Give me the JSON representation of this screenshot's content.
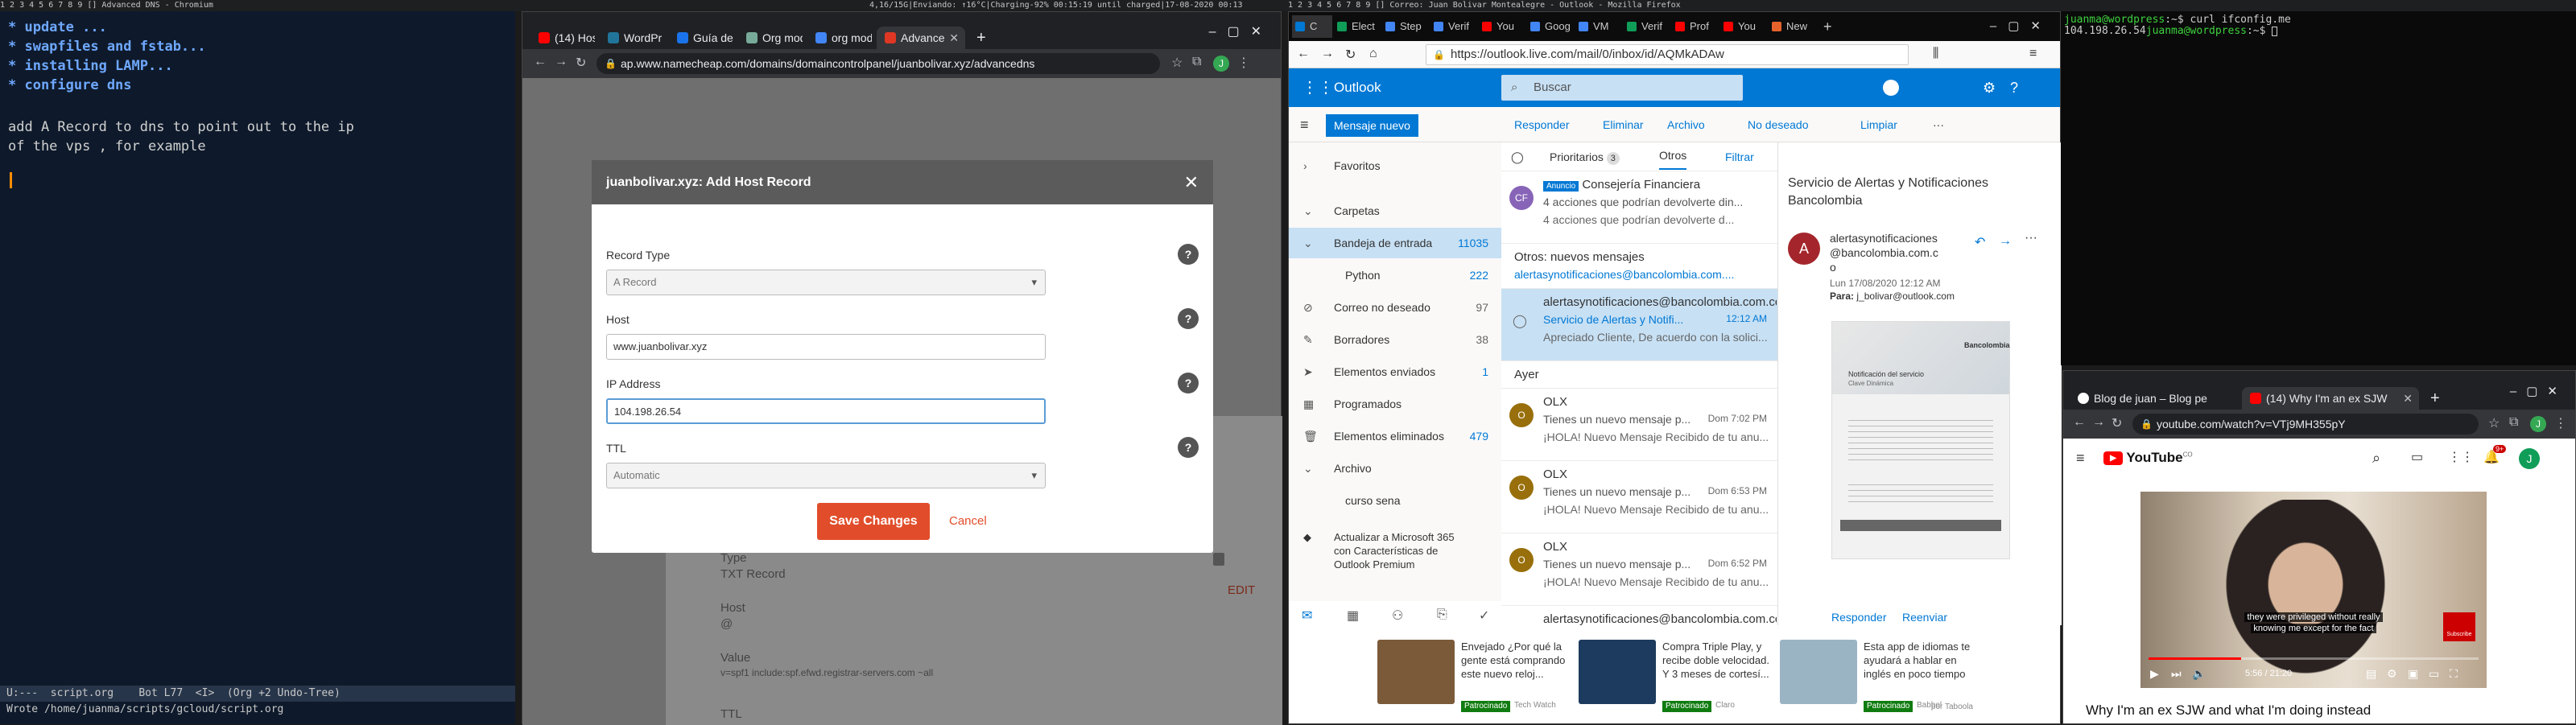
{
  "topbar_left": "1 2 3 4 5 6 7 8 9 [] Advanced DNS - Chromium",
  "topbar_mid": "4,16/15G|Enviando: ↑16°C|Charging-92% 00:15:19 until charged|17-08-2020 00:13",
  "topbar_right": "1 2 3 4 5 6 7 8 9 [] Correo: Juan Bolivar Montealegre - Outlook - Mozilla Firefox",
  "emacs": {
    "lines": [
      "* update ...",
      "* swapfiles and fstab...",
      "* installing LAMP...",
      "* configure dns"
    ],
    "body": [
      "add A Record to dns to point out to the ip",
      "of the vps , for example"
    ],
    "modeline": "U:---  script.org    Bot L77  <I>  (Org +2 Undo-Tree)",
    "minibuffer": "Wrote /home/juanma/scripts/gcloud/script.org"
  },
  "chrome1": {
    "tabs": [
      {
        "label": "(14) Hos",
        "color": "#ff0000"
      },
      {
        "label": "WordPr",
        "color": "#21759b"
      },
      {
        "label": "Guía de",
        "color": "#1a73e8"
      },
      {
        "label": "Org mod",
        "color": "#77aa99"
      },
      {
        "label": "org mod",
        "color": "#4285f4"
      },
      {
        "label": "Advance",
        "color": "#de3723"
      }
    ],
    "url": "ap.www.namecheap.com/domains/domaincontrolpanel/juanbolivar.xyz/advancedns",
    "avatar": "J"
  },
  "modal": {
    "title": "juanbolivar.xyz: Add Host Record",
    "record_type_label": "Record Type",
    "record_type_value": "A Record",
    "host_label": "Host",
    "host_value": "www.juanbolivar.xyz",
    "ip_label": "IP Address",
    "ip_value": "104.198.26.54",
    "ttl_label": "TTL",
    "ttl_value": "Automatic",
    "save_label": "Save Changes",
    "cancel_label": "Cancel",
    "help": "?"
  },
  "bg_records": {
    "type_label": "Type",
    "type_value": "TXT Record",
    "host_label": "Host",
    "host_value": "@",
    "value_label": "Value",
    "value_value": "v=spf1 include:spf.efwd.registrar-servers.com ~all",
    "ttl_label": "TTL",
    "edit_label": "EDIT"
  },
  "firefox": {
    "tabs": [
      {
        "label": "C",
        "color": "#0078d4"
      },
      {
        "label": "Elect",
        "color": "#0f9d58"
      },
      {
        "label": "Step",
        "color": "#4285f4"
      },
      {
        "label": "Verif",
        "color": "#4285f4"
      },
      {
        "label": "You",
        "color": "#ff0000"
      },
      {
        "label": "Goog",
        "color": "#4285f4"
      },
      {
        "label": "VM",
        "color": "#4285f4"
      },
      {
        "label": "Verif",
        "color": "#0f9d58"
      },
      {
        "label": "Prof",
        "color": "#ff0000"
      },
      {
        "label": "You",
        "color": "#ff0000"
      },
      {
        "label": "New",
        "color": "#e8632b"
      }
    ],
    "url": "https://outlook.live.com/mail/0/inbox/id/AQMkADAw"
  },
  "outlook": {
    "app_name": "Outlook",
    "search_placeholder": "Buscar",
    "new_message": "Mensaje nuevo",
    "commands": [
      "Responder",
      "Eliminar",
      "Archivo",
      "No deseado",
      "Limpiar",
      "···"
    ],
    "nav": [
      {
        "label": "Favoritos",
        "count": ""
      },
      {
        "label": "Carpetas",
        "count": ""
      },
      {
        "label": "Bandeja de entrada",
        "count": "11035"
      },
      {
        "label": "Python",
        "count": "222"
      },
      {
        "label": "Correo no deseado",
        "count": "97"
      },
      {
        "label": "Borradores",
        "count": "38"
      },
      {
        "label": "Elementos enviados",
        "count": "1"
      },
      {
        "label": "Programados",
        "count": ""
      },
      {
        "label": "Elementos eliminados",
        "count": "479"
      },
      {
        "label": "Archivo",
        "count": ""
      },
      {
        "label": "curso sena",
        "count": ""
      }
    ],
    "upgrade": [
      "Actualizar a Microsoft 365",
      "con Características de",
      "Outlook Premium"
    ],
    "list_tabs": {
      "focused": "Prioritarios",
      "focused_count": "3",
      "other": "Otros",
      "filter": "Filtrar"
    },
    "messages": [
      {
        "avatar": "CF",
        "color": "#8764b8",
        "badge": "Anuncio",
        "from": "Consejería Financiera",
        "subject": "4 acciones que podrían devolverte din...",
        "preview": "4 acciones que podrían devolverte d...",
        "time": ""
      },
      {
        "avatar": "",
        "color": "",
        "badge": "",
        "from": "Otros: nuevos mensajes",
        "subject": "alertasynotificaciones@bancolombia.com....",
        "preview": "",
        "time": ""
      },
      {
        "avatar": "",
        "color": "",
        "badge": "",
        "from": "alertasynotificaciones@bancolombia.com.cc",
        "subject": "Servicio de Alertas y Notifi...",
        "preview": "Apreciado Cliente, De acuerdo con la solici...",
        "time": "12:12 AM"
      },
      {
        "avatar": "",
        "color": "",
        "badge": "",
        "from": "Ayer",
        "subject": "",
        "preview": "",
        "time": ""
      },
      {
        "avatar": "O",
        "color": "#986f0b",
        "badge": "",
        "from": "OLX",
        "subject": "Tienes un nuevo mensaje p...",
        "preview": "¡HOLA! Nuevo Mensaje Recibido de tu anu...",
        "time": "Dom 7:02 PM"
      },
      {
        "avatar": "O",
        "color": "#986f0b",
        "badge": "",
        "from": "OLX",
        "subject": "Tienes un nuevo mensaje p...",
        "preview": "¡HOLA! Nuevo Mensaje Recibido de tu anu...",
        "time": "Dom 6:53 PM"
      },
      {
        "avatar": "O",
        "color": "#986f0b",
        "badge": "",
        "from": "OLX",
        "subject": "Tienes un nuevo mensaje p...",
        "preview": "¡HOLA! Nuevo Mensaje Recibido de tu anu...",
        "time": "Dom 6:52 PM"
      },
      {
        "avatar": "",
        "color": "",
        "badge": "",
        "from": "alertasynotificaciones@bancolombia.com.cc",
        "subject": "",
        "preview": "",
        "time": ""
      }
    ],
    "reading": {
      "subject": "Servicio de Alertas y Notificaciones Bancolombia",
      "sender_avatar": "A",
      "sender": [
        "alertasynotificaciones",
        "@bancolombia.com.c",
        "o"
      ],
      "date": "Lun 17/08/2020 12:12 AM",
      "to_label": "Para:",
      "to": "j_bolivar@outlook.com",
      "reply": "Responder",
      "forward": "Reenviar",
      "email_heading": "Notificación del servicio",
      "email_sub": "Clave Dinámica",
      "email_brand": "Bancolombia"
    },
    "ads": [
      {
        "text": "Envejado ¿Por qué la gente está comprando este nuevo reloj...",
        "badge": "Patrocinado",
        "source": "Tech Watch",
        "color": "#7b5a3a"
      },
      {
        "text": "Compra Triple Play, y recibe doble velocidad. Y 3 meses de cortesí...",
        "badge": "Patrocinado",
        "source": "Claro",
        "color": "#1c3b5e"
      },
      {
        "text": "Esta app de idiomas te ayudará a hablar en inglés en poco tiempo",
        "badge": "Patrocinado",
        "source": "Babbel",
        "color": "#9bb4c4"
      }
    ],
    "taboola": "por Taboola"
  },
  "terminal": {
    "prompt_user": "juanma@wordpress",
    "cmd": ":~$ curl ifconfig.me",
    "output": "104.198.26.54",
    "prompt2": ":~$ "
  },
  "youtube": {
    "tabs": [
      {
        "label": "Blog de juan – Blog pe",
        "color": "#ffffff"
      },
      {
        "label": "(14) Why I'm an ex SJW",
        "color": "#ff0000"
      }
    ],
    "url": "youtube.com/watch?v=VTj9MH355pY",
    "logo": "YouTube",
    "logo_sup": "CO",
    "notif": "9+",
    "avatar": "J",
    "subtitle": [
      "they were privileged without really",
      "knowing me except for the fact"
    ],
    "time": "5:56 / 21:20",
    "subscribe": "Subscribe",
    "title": "Why I'm an ex SJW and what I'm doing instead",
    "progress": 0.28
  }
}
